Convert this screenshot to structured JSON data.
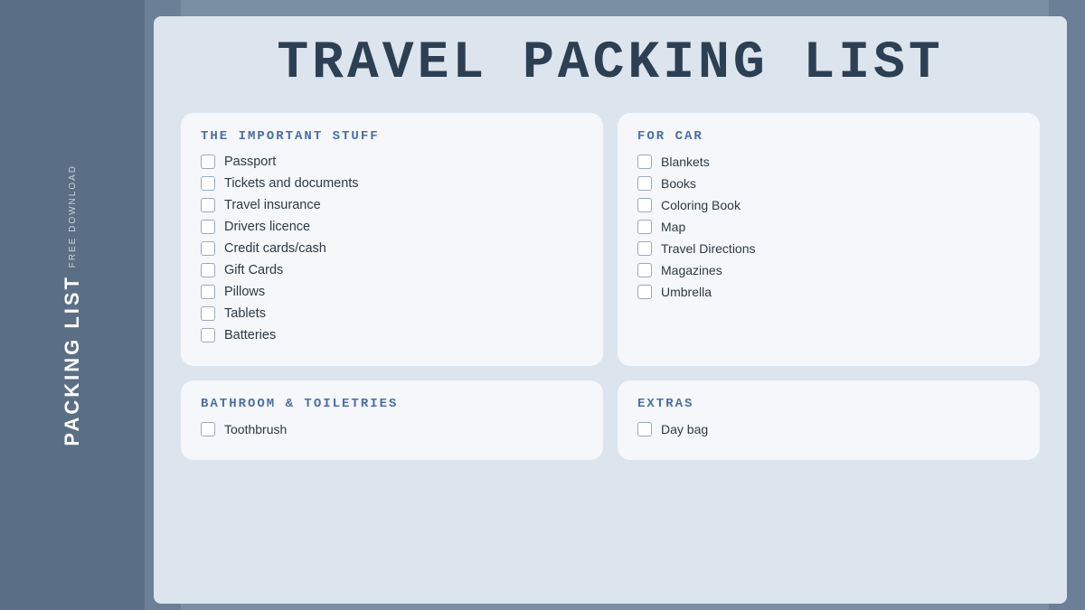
{
  "sidebar": {
    "free_download": "FREE DOWNLOAD",
    "packing_list": "PACKING LIST"
  },
  "page": {
    "title": "TRAVEL PACKING LIST"
  },
  "sections": [
    {
      "id": "important",
      "title": "THE IMPORTANT STUFF",
      "items": [
        "Passport",
        "Tickets and documents",
        "Travel insurance",
        "Drivers licence",
        "Credit cards/cash",
        "Gift Cards",
        "Pillows",
        "Tablets",
        "Batteries"
      ]
    },
    {
      "id": "car",
      "title": "FOR CAR",
      "items": [
        "Blankets",
        "Books",
        "Coloring Book",
        "Map",
        "Travel Directions",
        "Magazines",
        "Umbrella"
      ]
    },
    {
      "id": "bathroom",
      "title": "BATHROOM & TOILETRIES",
      "items": [
        "Toothbrush"
      ]
    },
    {
      "id": "extras",
      "title": "EXTRAS",
      "items": [
        "Day bag"
      ]
    }
  ]
}
